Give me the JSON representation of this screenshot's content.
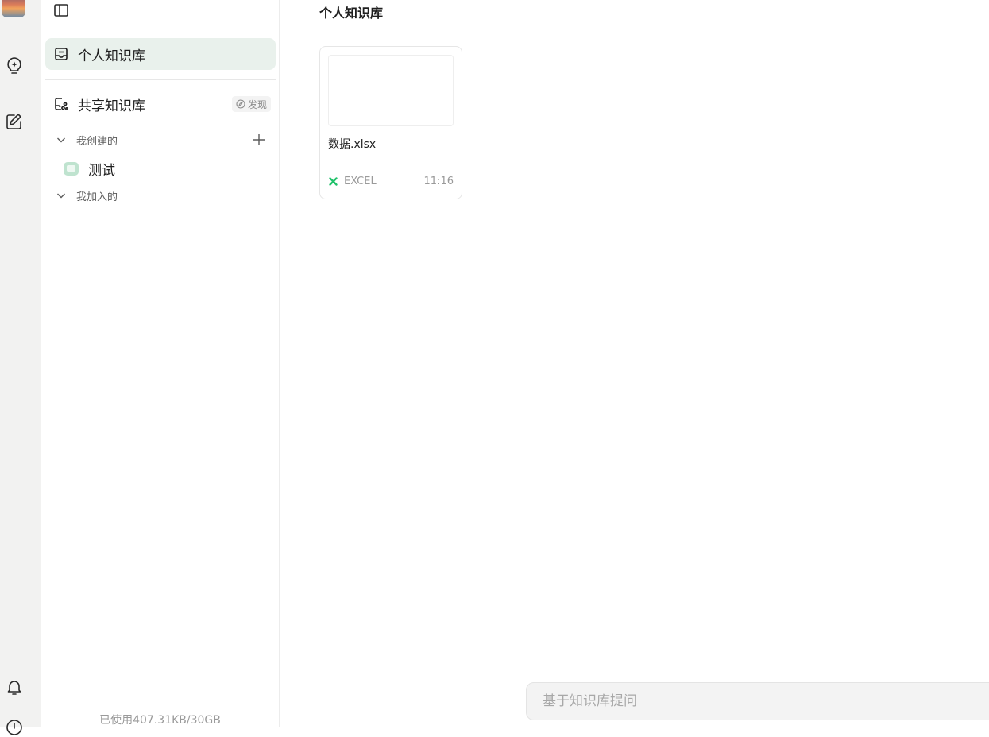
{
  "rail": {
    "icons": [
      "avatar",
      "bulb-sparkle-icon",
      "edit-note-icon",
      "bell-icon",
      "info-icon"
    ]
  },
  "sidebar": {
    "personal_kb_label": "个人知识库",
    "shared_kb_label": "共享知识库",
    "discover_label": "发现",
    "created_group_label": "我创建的",
    "joined_group_label": "我加入的",
    "created_items": [
      {
        "label": "测试"
      }
    ],
    "usage_text": "已使用407.31KB/30GB"
  },
  "main": {
    "title": "个人知识库",
    "files": [
      {
        "name": "数据.xlsx",
        "type": "EXCEL",
        "time": "11:16"
      }
    ],
    "ask_placeholder": "基于知识库提问"
  },
  "colors": {
    "active_bg": "#e9f1ec",
    "excel_green": "#21c26b",
    "kb_badge": "#bfe3cf"
  }
}
